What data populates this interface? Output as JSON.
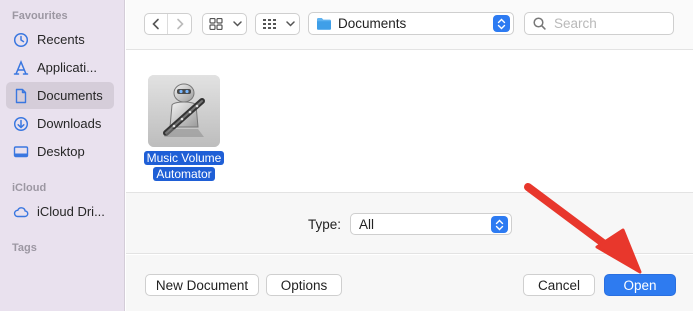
{
  "sidebar": {
    "favourites_label": "Favourites",
    "icloud_label": "iCloud",
    "tags_label": "Tags",
    "items": [
      {
        "label": "Recents",
        "icon": "clock-icon",
        "selected": false
      },
      {
        "label": "Applicati...",
        "icon": "applications-icon",
        "selected": false
      },
      {
        "label": "Documents",
        "icon": "document-icon",
        "selected": true
      },
      {
        "label": "Downloads",
        "icon": "download-icon",
        "selected": false
      },
      {
        "label": "Desktop",
        "icon": "desktop-icon",
        "selected": false
      }
    ],
    "icloud_items": [
      {
        "label": "iCloud Dri...",
        "icon": "cloud-icon"
      }
    ]
  },
  "toolbar": {
    "location": "Documents",
    "search_placeholder": "Search"
  },
  "files": [
    {
      "name_line1": "Music Volume",
      "name_line2": "Automator",
      "selected": true,
      "icon": "automator-icon"
    }
  ],
  "type_filter": {
    "label": "Type:",
    "value": "All"
  },
  "buttons": {
    "new_document": "New Document",
    "options": "Options",
    "cancel": "Cancel",
    "open": "Open"
  },
  "colors": {
    "accent": "#2e7bf0",
    "sidebar_bg": "#e9e1ee",
    "annotation_arrow": "#e8372c"
  }
}
